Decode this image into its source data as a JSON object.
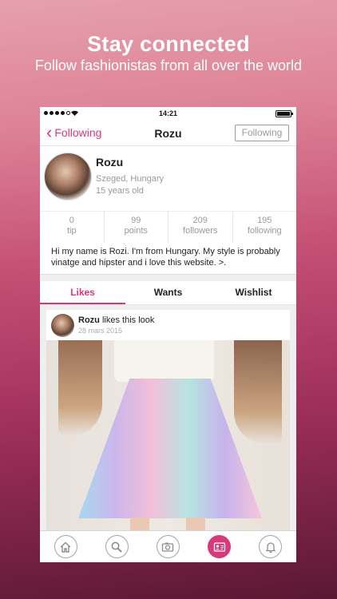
{
  "promo": {
    "title": "Stay connected",
    "subtitle": "Follow fashionistas from all over the world"
  },
  "status_bar": {
    "time": "14:21"
  },
  "nav": {
    "back_label": "Following",
    "title": "Rozu",
    "follow_button": "Following"
  },
  "profile": {
    "name": "Rozu",
    "location": "Szeged, Hungary",
    "age": "15 years old",
    "stats": [
      {
        "value": "0",
        "label": "tip"
      },
      {
        "value": "99",
        "label": "points"
      },
      {
        "value": "209",
        "label": "followers"
      },
      {
        "value": "195",
        "label": "following"
      }
    ],
    "bio": "Hi my name is Rozi. I'm from Hungary. My style is probably vinatge and hipster and i love this website. >."
  },
  "tabs": [
    {
      "label": "Likes",
      "active": true
    },
    {
      "label": "Wants",
      "active": false
    },
    {
      "label": "Wishlist",
      "active": false
    }
  ],
  "feed": {
    "user": "Rozu",
    "action": "likes this look",
    "date": "28 mars 2015"
  },
  "tab_bar": {
    "icons": [
      "home-icon",
      "search-icon",
      "camera-icon",
      "profile-card-icon",
      "bell-icon"
    ],
    "active_index": 3,
    "accent_color": "#d9387c"
  }
}
